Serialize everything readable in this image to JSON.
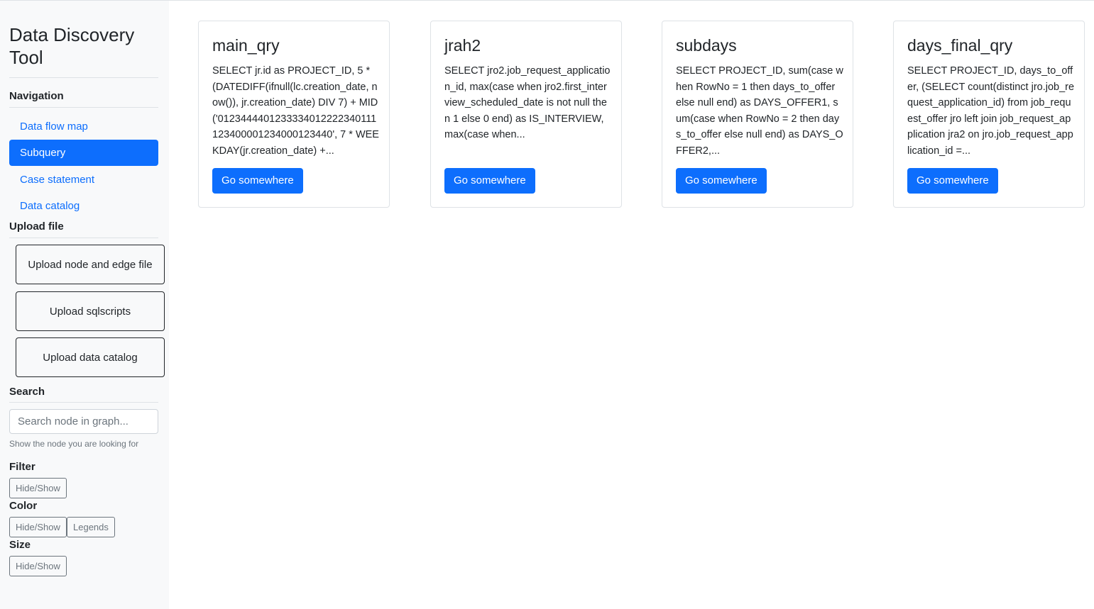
{
  "sidebar": {
    "title": "Data Discovery Tool",
    "navigation": {
      "heading": "Navigation",
      "items": [
        {
          "label": "Data flow map"
        },
        {
          "label": "Subquery"
        },
        {
          "label": "Case statement"
        },
        {
          "label": "Data catalog"
        }
      ],
      "active": "Subquery"
    },
    "upload": {
      "heading": "Upload file",
      "buttons": [
        {
          "label": "Upload node and edge file"
        },
        {
          "label": "Upload sqlscripts"
        },
        {
          "label": "Upload data catalog"
        }
      ]
    },
    "search": {
      "heading": "Search",
      "placeholder": "Search node in graph...",
      "help": "Show the node you are looking for"
    },
    "filter": {
      "heading": "Filter",
      "toggle_label": "Hide/Show"
    },
    "color": {
      "heading": "Color",
      "toggle_label": "Hide/Show",
      "legends_label": "Legends"
    },
    "size": {
      "heading": "Size",
      "toggle_label": "Hide/Show"
    }
  },
  "cards": [
    {
      "title": "main_qry",
      "text": "SELECT jr.id as PROJECT_ID, 5 * (DATEDIFF(ifnull(lc.creation_date, now()), jr.creation_date) DIV 7) + MID('0123444401233334012222340111123400001234000123440', 7 * WEEKDAY(jr.creation_date) +...",
      "button": "Go somewhere"
    },
    {
      "title": "jrah2",
      "text": "SELECT jro2.job_request_application_id, max(case when jro2.first_interview_scheduled_date is not null then 1 else 0 end) as IS_INTERVIEW, max(case when...",
      "button": "Go somewhere"
    },
    {
      "title": "subdays",
      "text": "SELECT PROJECT_ID, sum(case when RowNo = 1 then days_to_offer else null end) as DAYS_OFFER1, sum(case when RowNo = 2 then days_to_offer else null end) as DAYS_OFFER2,...",
      "button": "Go somewhere"
    },
    {
      "title": "days_final_qry",
      "text": "SELECT PROJECT_ID, days_to_offer, (SELECT count(distinct jro.job_request_application_id) from job_request_offer jro left join job_request_application jra2 on jro.job_request_application_id =...",
      "button": "Go somewhere"
    }
  ],
  "colors": {
    "primary": "#0d6efd",
    "sidebar_bg": "#f8f9fa",
    "border": "#dee2e6",
    "muted": "#6c757d"
  }
}
